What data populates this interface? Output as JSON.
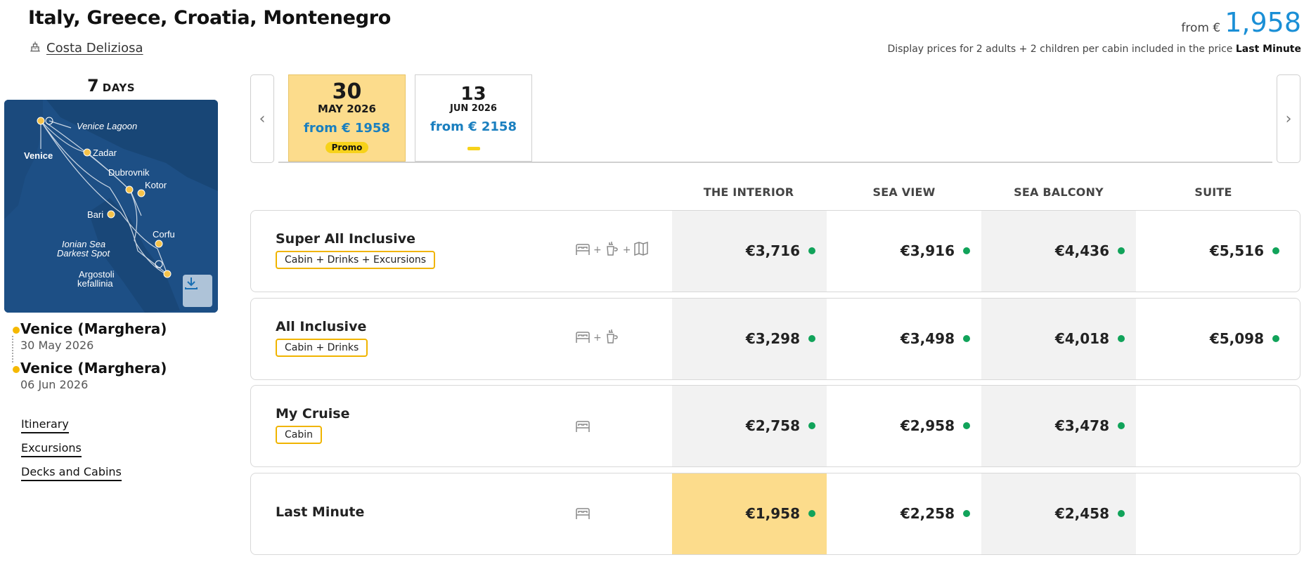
{
  "header": {
    "title": "Italy, Greece, Croatia, Montenegro",
    "ship_name": "Costa Deliziosa",
    "price_from_label": "from €",
    "price_from_amount": "1,958",
    "price_note": "Display prices for 2 adults + 2 children per cabin included in the price",
    "price_note_bold": "Last Minute"
  },
  "itinerary": {
    "days_number": "7",
    "days_label": "DAYS",
    "map_labels": [
      "Venice Lagoon",
      "Venice",
      "Zadar",
      "Dubrovnik",
      "Kotor",
      "Bari",
      "Corfu",
      "Ionian Sea",
      "Darkest Spot",
      "Argostoli",
      "kefallinia"
    ],
    "departure": {
      "port": "Venice (Marghera)",
      "date": "30 May 2026"
    },
    "arrival": {
      "port": "Venice (Marghera)",
      "date": "06 Jun 2026"
    },
    "links": [
      "Itinerary",
      "Excursions",
      "Decks and Cabins"
    ]
  },
  "dates": [
    {
      "day": "30",
      "month": "MAY 2026",
      "price": "from € 1958",
      "badge": "Promo",
      "active": true
    },
    {
      "day": "13",
      "month": "JUN 2026",
      "price": "from € 2158",
      "badge": "",
      "active": false
    }
  ],
  "columns": [
    "THE INTERIOR",
    "SEA VIEW",
    "SEA BALCONY",
    "SUITE"
  ],
  "rows": [
    {
      "name": "Super All Inclusive",
      "tag": "Cabin + Drinks + Excursions",
      "icons": [
        "bed-icon",
        "drink-icon",
        "map-icon"
      ],
      "prices": [
        "€3,716",
        "€3,916",
        "€4,436",
        "€5,516"
      ]
    },
    {
      "name": "All Inclusive",
      "tag": "Cabin + Drinks",
      "icons": [
        "bed-icon",
        "drink-icon"
      ],
      "prices": [
        "€3,298",
        "€3,498",
        "€4,018",
        "€5,098"
      ]
    },
    {
      "name": "My Cruise",
      "tag": "Cabin",
      "icons": [
        "bed-icon"
      ],
      "prices": [
        "€2,758",
        "€2,958",
        "€3,478",
        ""
      ]
    },
    {
      "name": "Last Minute",
      "tag": "",
      "icons": [
        "bed-icon"
      ],
      "prices": [
        "€1,958",
        "€2,258",
        "€2,458",
        ""
      ]
    }
  ],
  "plus_sign": "+",
  "colors": {
    "accent_blue": "#1a8fd6",
    "promo_yellow": "#f7d21a",
    "highlight": "#fcdc8c",
    "available_green": "#11a35a",
    "map_sea": "#1d4f85"
  }
}
